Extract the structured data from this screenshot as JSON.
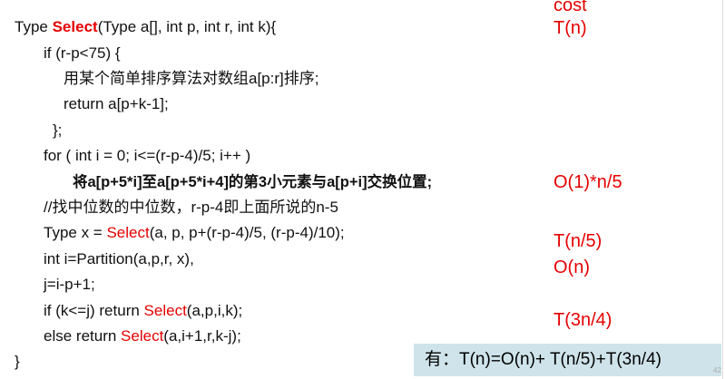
{
  "code": {
    "l1_a": "Type ",
    "l1_kw": "Select",
    "l1_b": "(Type a[], int p, int r, int k){",
    "l2": "if (r-p<75) {",
    "l3": "用某个简单排序算法对数组a[p:r]排序;",
    "l4": "return a[p+k-1];",
    "l5": "};",
    "l6": "for ( int i = 0; i<=(r-p-4)/5; i++ )",
    "l7": "将a[p+5*i]至a[p+5*i+4]的第3小元素与a[p+i]交换位置;",
    "l8": "//找中位数的中位数，r-p-4即上面所说的n-5",
    "l9_a": "Type x = ",
    "l9_kw": "Select",
    "l9_b": "(a, p, p+(r-p-4)/5, (r-p-4)/10);",
    "l10": "int i=Partition(a,p,r, x),",
    "l11": "j=i-p+1;",
    "l12_a": "if (k<=j) return ",
    "l12_kw": "Select",
    "l12_b": "(a,p,i,k);",
    "l13_a": "else return ",
    "l13_kw": "Select",
    "l13_b": "(a,i+1,r,k-j);",
    "l14": "}"
  },
  "costs": {
    "header": "cost",
    "c1": "T(n)",
    "c2": "O(1)*n/5",
    "c3": "T(n/5)",
    "c4": "O(n)",
    "c5": "T(3n/4)"
  },
  "formula": "有：T(n)=O(n)+ T(n/5)+T(3n/4)",
  "page_number": "42",
  "colors": {
    "keyword": "#e60000",
    "formula_bg": "#cfe4ea"
  }
}
